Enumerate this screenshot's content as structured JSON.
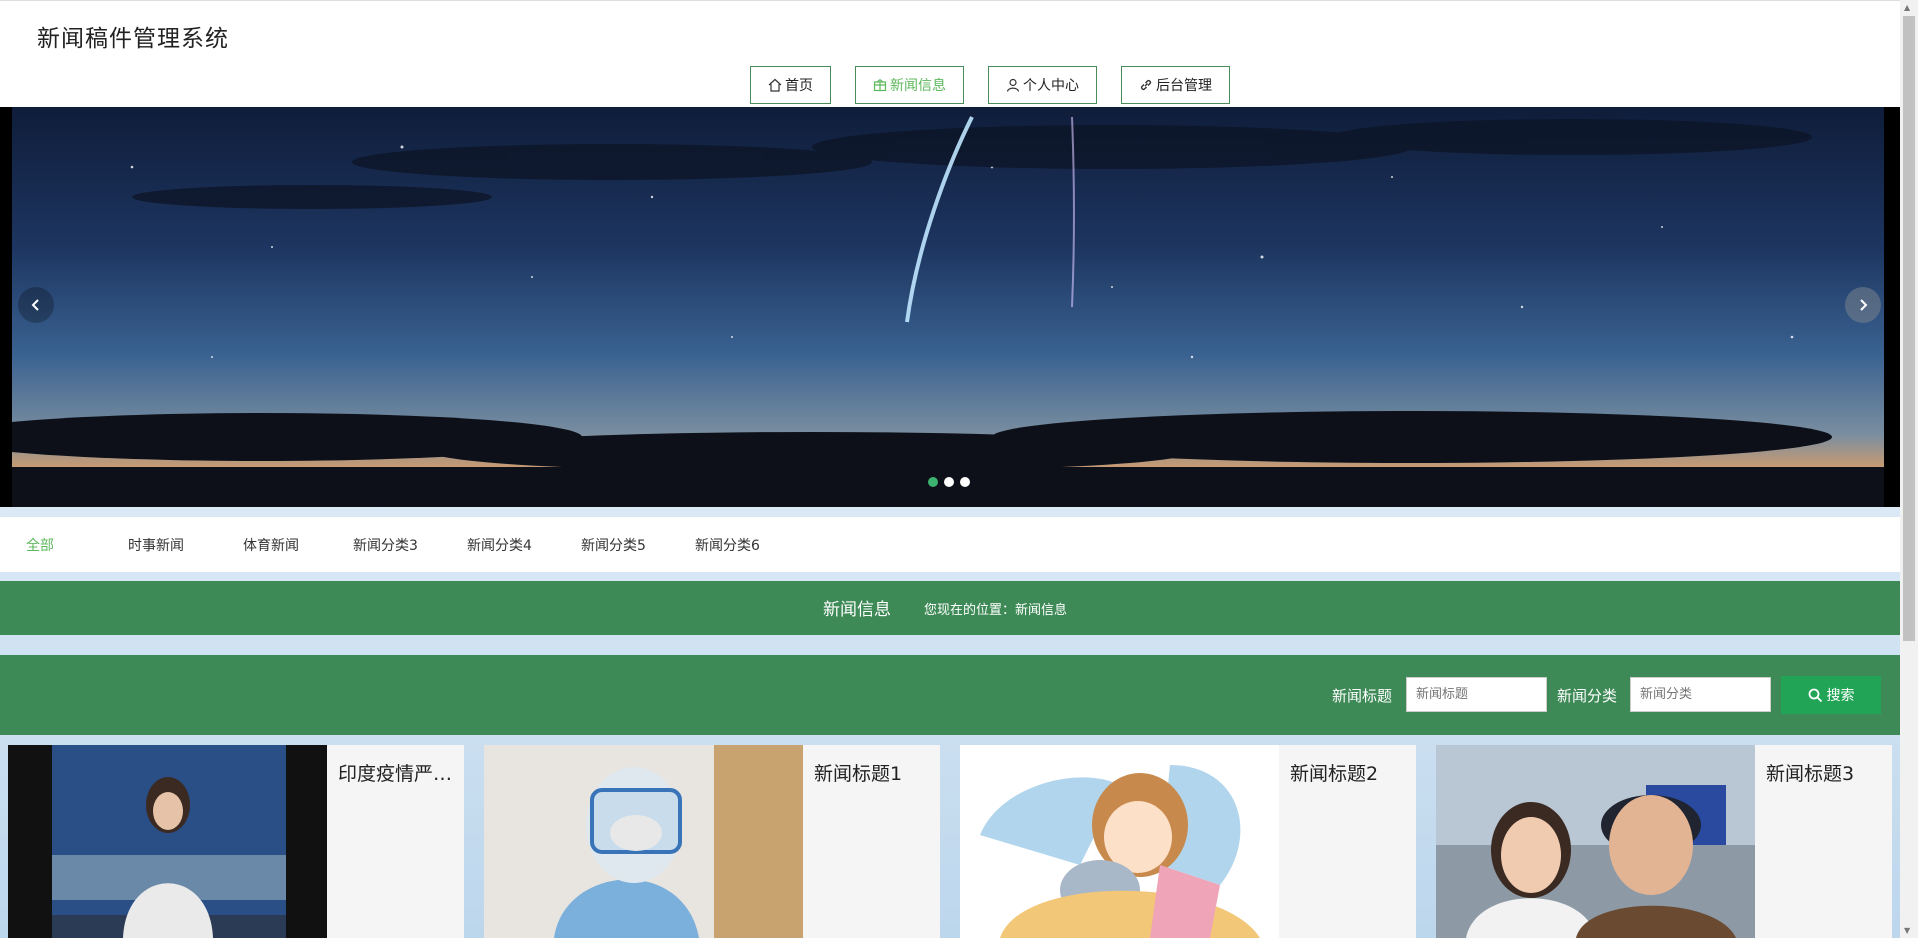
{
  "header": {
    "site_title": "新闻稿件管理系统"
  },
  "nav": [
    {
      "label": "首页",
      "icon": "home-icon",
      "active": false
    },
    {
      "label": "新闻信息",
      "icon": "news-icon",
      "active": true
    },
    {
      "label": "个人中心",
      "icon": "user-icon",
      "active": false
    },
    {
      "label": "后台管理",
      "icon": "link-icon",
      "active": false
    }
  ],
  "carousel": {
    "slide_count": 3,
    "active_slide": 1
  },
  "categories": [
    "全部",
    "时事新闻",
    "体育新闻",
    "新闻分类3",
    "新闻分类4",
    "新闻分类5",
    "新闻分类6"
  ],
  "section": {
    "title": "新闻信息",
    "breadcrumb": "您现在的位置：新闻信息"
  },
  "search": {
    "title_label": "新闻标题",
    "title_placeholder": "新闻标题",
    "category_label": "新闻分类",
    "category_placeholder": "新闻分类",
    "button_label": "搜索"
  },
  "cards": [
    {
      "title": "印度疫情严重爆发"
    },
    {
      "title": "新闻标题1"
    },
    {
      "title": "新闻标题2"
    },
    {
      "title": "新闻标题3"
    }
  ],
  "colors": {
    "primary_green": "#3e8a57",
    "button_green": "#22a457",
    "active_text": "#5cb85c"
  }
}
